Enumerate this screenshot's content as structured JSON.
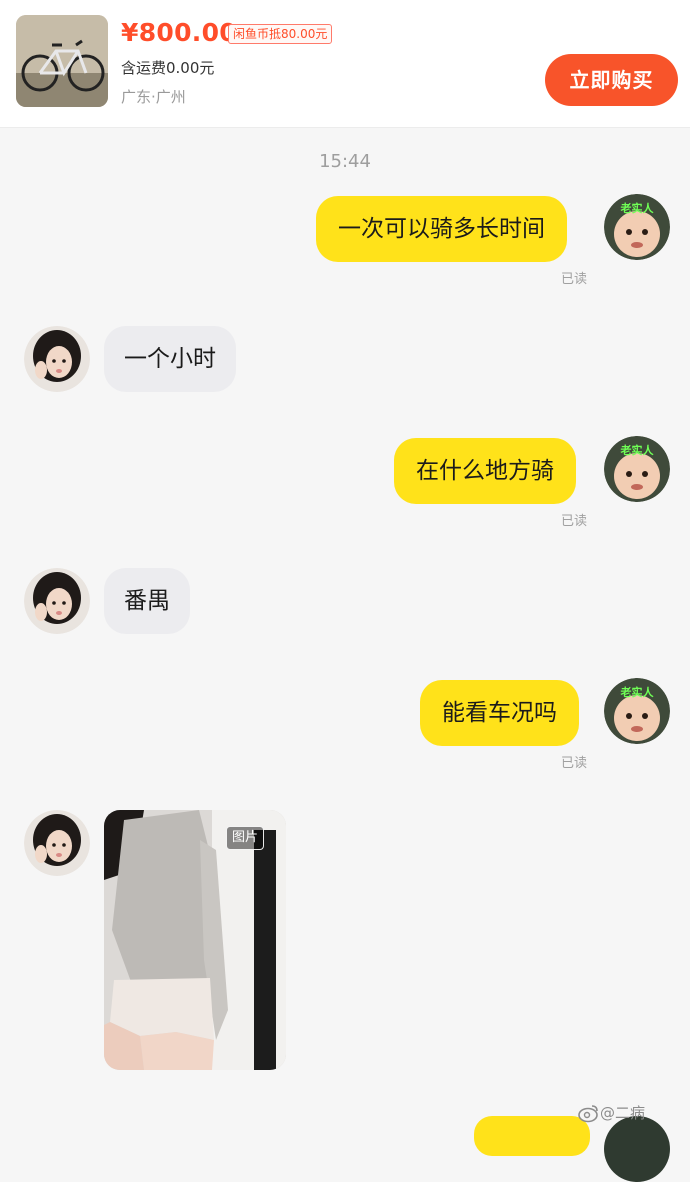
{
  "header": {
    "price": "¥800.00",
    "coin_tag": "闲鱼币抵80.00元",
    "shipping": "含运费0.00元",
    "location": "广东·广州",
    "buy_button": "立即购买"
  },
  "chat": {
    "timestamp": "15:44",
    "avatar_badge": "老实人",
    "read_label": "已读",
    "messages": [
      {
        "from": "me",
        "text": "一次可以骑多长时间"
      },
      {
        "from": "them",
        "text": "一个小时"
      },
      {
        "from": "me",
        "text": "在什么地方骑"
      },
      {
        "from": "them",
        "text": "番禺"
      },
      {
        "from": "me",
        "text": "能看车况吗"
      },
      {
        "from": "them",
        "type": "image",
        "tag": "图片"
      }
    ]
  },
  "watermark": {
    "text": "@二病"
  },
  "colors": {
    "accent": "#f8542a",
    "my_bubble": "#ffe21a",
    "their_bubble": "#ececef"
  },
  "icons": [
    "bicycle-thumbnail",
    "weibo-icon"
  ]
}
